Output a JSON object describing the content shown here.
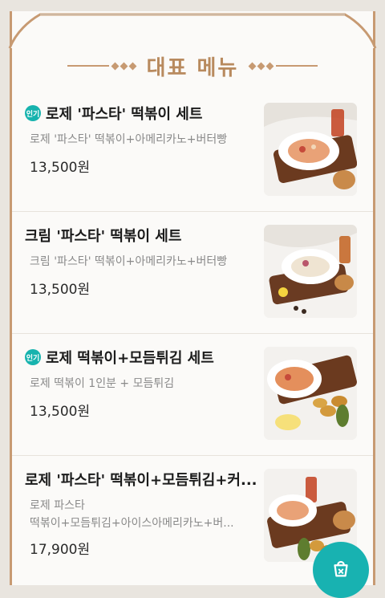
{
  "section": {
    "title": "대표 메뉴"
  },
  "colors": {
    "accent": "#c79a72",
    "badge": "#17b3ae",
    "cart": "#18b2b1"
  },
  "menu": [
    {
      "badge": "인기",
      "name": "로제 '파스타' 떡볶이 세트",
      "desc": "로제 '파스타' 떡볶이+아메리카노+버터빵",
      "price": "13,500원",
      "image_icon": "pasta-set-photo"
    },
    {
      "badge": "",
      "name": "크림 '파스타' 떡볶이 세트",
      "desc": "크림 '파스타' 떡볶이+아메리카노+버터빵",
      "price": "13,500원",
      "image_icon": "cream-pasta-set-photo"
    },
    {
      "badge": "인기",
      "name": "로제 떡볶이+모듬튀김 세트",
      "desc": "로제 떡볶이 1인분 + 모듬튀김",
      "price": "13,500원",
      "image_icon": "tteokbokki-fried-set-photo"
    },
    {
      "badge": "",
      "name": "로제 '파스타' 떡볶이+모듬튀김+커...",
      "desc_lines": [
        "로제 파스타",
        "떡볶이+모듬튀김+아이스아메리카노+버..."
      ],
      "price": "17,900원",
      "image_icon": "combo-set-photo"
    }
  ],
  "cart": {
    "icon": "cart-icon"
  }
}
